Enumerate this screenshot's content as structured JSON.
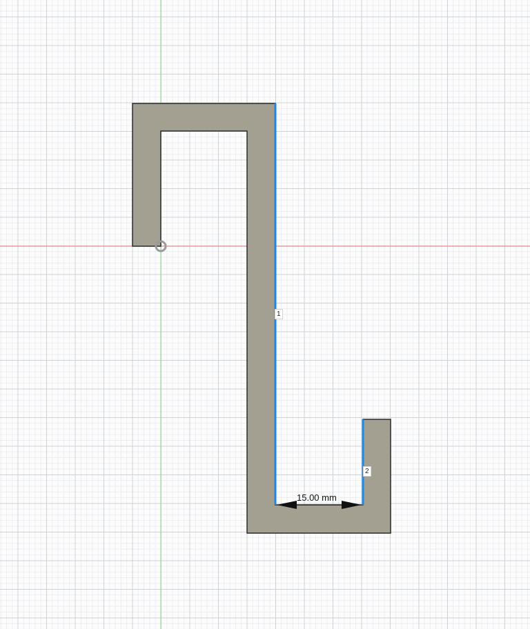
{
  "sketch": {
    "profile_fill": "#a39f91",
    "profile_stroke": "#2a2a2a",
    "selected_edge_color": "#1e88e5",
    "x_axis_color": "#f08080",
    "y_axis_color": "#8fdc8f",
    "constraints": [
      {
        "label": "1"
      },
      {
        "label": "2"
      }
    ],
    "dimension": {
      "text": "15.00 mm"
    }
  }
}
